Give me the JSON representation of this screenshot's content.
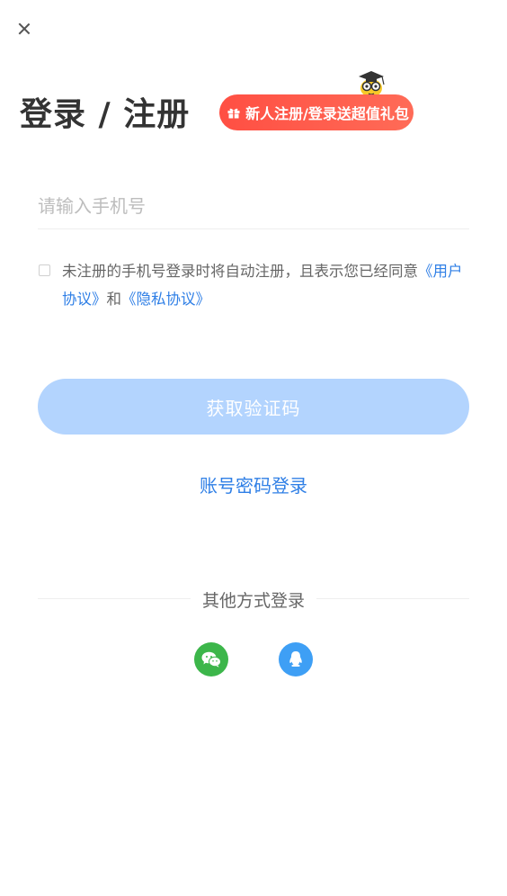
{
  "title": "登录 / 注册",
  "promo": {
    "text": "新人注册/登录送超值礼包",
    "color_start": "#ff4f43",
    "color_end": "#ff6b57"
  },
  "phone_input": {
    "placeholder": "请输入手机号",
    "value": ""
  },
  "agreement": {
    "checked": false,
    "text": "未注册的手机号登录时将自动注册，且表示您已经同意",
    "user_agreement": "《用户协议》",
    "and": "和",
    "privacy_agreement": "《隐私协议》"
  },
  "get_code_button": "获取验证码",
  "password_login": "账号密码登录",
  "other_login": {
    "title": "其他方式登录",
    "icons": [
      "wechat-icon",
      "qq-icon"
    ]
  },
  "colors": {
    "accent": "#2f7fe6",
    "button_disabled": "#b3d4fe",
    "wechat": "#3cb64a",
    "qq": "#3e9ff5"
  }
}
